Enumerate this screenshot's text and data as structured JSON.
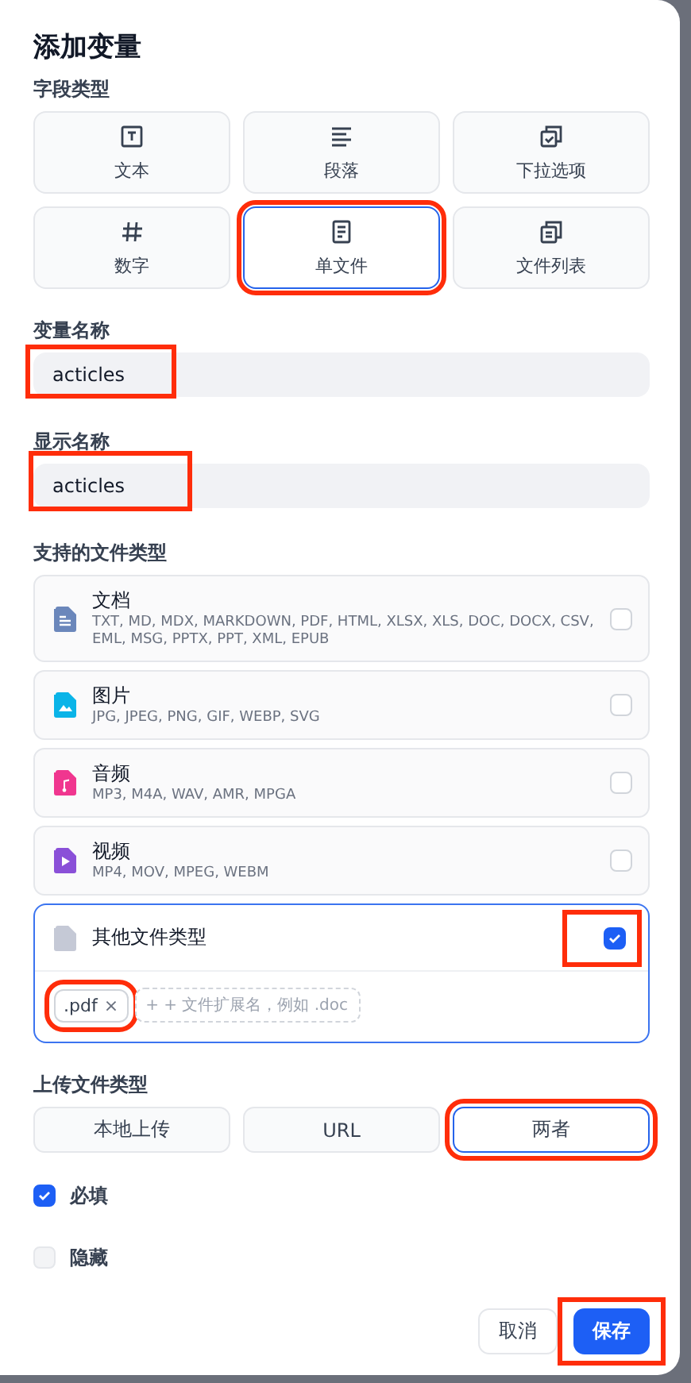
{
  "title": "添加变量",
  "field_type": {
    "label": "字段类型",
    "options": [
      {
        "kind": "text",
        "label": "文本",
        "selected": false,
        "highlighted": false
      },
      {
        "kind": "paragraph",
        "label": "段落",
        "selected": false,
        "highlighted": false
      },
      {
        "kind": "select",
        "label": "下拉选项",
        "selected": false,
        "highlighted": false
      },
      {
        "kind": "number",
        "label": "数字",
        "selected": false,
        "highlighted": false
      },
      {
        "kind": "file",
        "label": "单文件",
        "selected": true,
        "highlighted": true
      },
      {
        "kind": "file-list",
        "label": "文件列表",
        "selected": false,
        "highlighted": false
      }
    ]
  },
  "variable_name": {
    "label": "变量名称",
    "value": "acticles",
    "highlighted": true
  },
  "display_name": {
    "label": "显示名称",
    "value": "acticles",
    "highlighted": true
  },
  "file_types": {
    "label": "支持的文件类型",
    "items": [
      {
        "kind": "document",
        "name": "文档",
        "formats": "TXT, MD, MDX, MARKDOWN, PDF, HTML, XLSX, XLS, DOC, DOCX, CSV, EML, MSG, PPTX, PPT, XML, EPUB",
        "color": "#6b87bb",
        "checked": false,
        "highlighted": false
      },
      {
        "kind": "image",
        "name": "图片",
        "formats": "JPG, JPEG, PNG, GIF, WEBP, SVG",
        "color": "#0ab4e8",
        "checked": false,
        "highlighted": false
      },
      {
        "kind": "audio",
        "name": "音频",
        "formats": "MP3, M4A, WAV, AMR, MPGA",
        "color": "#f0368f",
        "checked": false,
        "highlighted": false
      },
      {
        "kind": "video",
        "name": "视频",
        "formats": "MP4, MOV, MPEG, WEBM",
        "color": "#8a50d8",
        "checked": false,
        "highlighted": false
      }
    ],
    "other": {
      "name": "其他文件类型",
      "color": "#c5c9d6",
      "checked": true,
      "highlighted": true,
      "tags": [
        {
          "label": ".pdf",
          "remove": "×",
          "highlighted": true
        }
      ],
      "placeholder": "+ + 文件扩展名，例如 .doc"
    }
  },
  "upload_type": {
    "label": "上传文件类型",
    "options": [
      {
        "label": "本地上传",
        "selected": false,
        "highlighted": false
      },
      {
        "label": "URL",
        "selected": false,
        "highlighted": false
      },
      {
        "label": "两者",
        "selected": true,
        "highlighted": true
      }
    ]
  },
  "options": [
    {
      "label": "必填",
      "checked": true
    },
    {
      "label": "隐藏",
      "checked": false
    }
  ],
  "buttons": {
    "cancel": {
      "label": "取消",
      "highlighted": false
    },
    "save": {
      "label": "保存",
      "highlighted": true
    }
  }
}
